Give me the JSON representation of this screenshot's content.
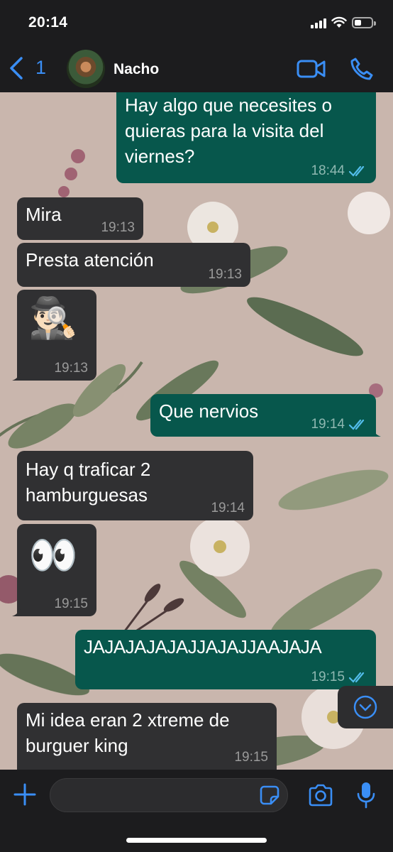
{
  "status_bar": {
    "time": "20:14"
  },
  "header": {
    "back_count": "1",
    "contact_name": "Nacho",
    "icons": {
      "back": "chevron-left-icon",
      "video": "video-camera-icon",
      "call": "phone-icon"
    }
  },
  "colors": {
    "accent": "#3a8ef5",
    "incoming_bubble": "#303032",
    "outgoing_bubble": "#07574c",
    "read_ticks": "#53bdeb"
  },
  "messages": [
    {
      "direction": "out",
      "text": "Hay algo que necesites o\nquieras para la visita del\nviernes?",
      "time": "18:44",
      "read": true
    },
    {
      "direction": "in",
      "text": "Mira",
      "time": "19:13"
    },
    {
      "direction": "in",
      "text": "Presta atención",
      "time": "19:13"
    },
    {
      "direction": "in",
      "text": "🕵🏻‍♂️",
      "time": "19:13"
    },
    {
      "direction": "out",
      "text": "Que nervios",
      "time": "19:14",
      "read": true
    },
    {
      "direction": "in",
      "text": "Hay q traficar 2\nhamburguesas",
      "time": "19:14"
    },
    {
      "direction": "in",
      "text": "👀",
      "time": "19:15"
    },
    {
      "direction": "out",
      "text": "JAJAJAJAJAJJAJAJJAAJAJA",
      "time": "19:15",
      "read": true
    },
    {
      "direction": "in",
      "text": "Mi idea eran 2 xtreme de\nburguer king",
      "time": "19:15"
    }
  ],
  "input": {
    "placeholder": ""
  }
}
